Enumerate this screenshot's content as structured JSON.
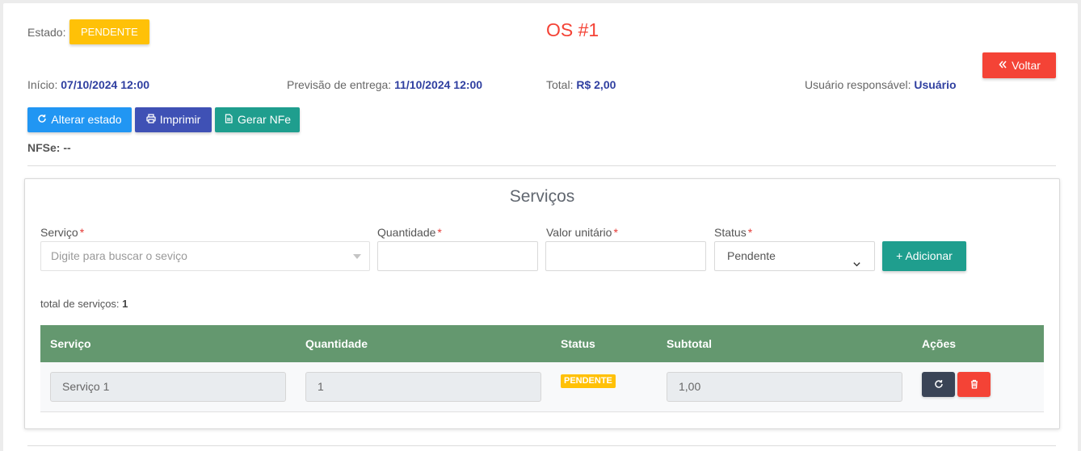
{
  "header": {
    "estado_label": "Estado:",
    "estado_value": "PENDENTE",
    "title": "OS #1",
    "back_label": "Voltar"
  },
  "info": {
    "inicio_label": "Início:",
    "inicio_value": "07/10/2024 12:00",
    "previsao_label": "Previsão de entrega:",
    "previsao_value": "11/10/2024 12:00",
    "total_label": "Total:",
    "total_value": "R$ 2,00",
    "usuario_label": "Usuário responsável:",
    "usuario_value": "Usuário"
  },
  "actions": {
    "alterar_label": "Alterar estado",
    "imprimir_label": "Imprimir",
    "gerar_label": "Gerar NFe"
  },
  "nfse": {
    "label": "NFSe:",
    "value": "--"
  },
  "servicos": {
    "title": "Serviços",
    "form": {
      "servico_label": "Serviço",
      "servico_placeholder": "Digite para buscar o seviço",
      "quantidade_label": "Quantidade",
      "valor_label": "Valor unitário",
      "status_label": "Status",
      "status_value": "Pendente",
      "required_mark": "*",
      "add_label": "+ Adicionar"
    },
    "count_label": "total de serviços:",
    "count_value": "1",
    "table": {
      "headers": [
        "Serviço",
        "Quantidade",
        "Status",
        "Subtotal",
        "Ações"
      ],
      "rows": [
        {
          "servico": "Serviço 1",
          "quantidade": "1",
          "status": "PENDENTE",
          "subtotal": "1,00"
        }
      ]
    }
  },
  "colors": {
    "danger": "#f44336",
    "warning": "#ffc107",
    "info": "#2196f3",
    "indigo": "#3f51b5",
    "teal": "#1f9e8e",
    "table_header": "#64986f",
    "dark": "#3a4456"
  },
  "icons": {
    "back": "double-chevron-left-icon",
    "alterar": "refresh-icon",
    "imprimir": "printer-icon",
    "gerar": "document-icon",
    "select": "chevron-down-icon",
    "row_refresh": "refresh-icon",
    "row_delete": "trash-icon"
  }
}
